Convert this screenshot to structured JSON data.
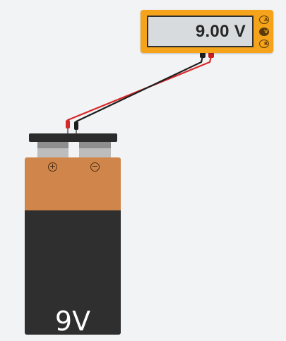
{
  "colors": {
    "background": "#f2f3f5",
    "meter_body": "#f5a31a",
    "meter_screen": "#d7dbde",
    "battery_cap": "#d0864a",
    "battery_body": "#2f2f2f",
    "lead_red": "#d62828",
    "lead_black": "#1e1e1e"
  },
  "multimeter": {
    "reading": "9.00 V",
    "modes": [
      "A",
      "V",
      "R"
    ],
    "active_mode": "V"
  },
  "battery": {
    "label": "9V",
    "positive_symbol": "+",
    "negative_symbol": "−"
  }
}
